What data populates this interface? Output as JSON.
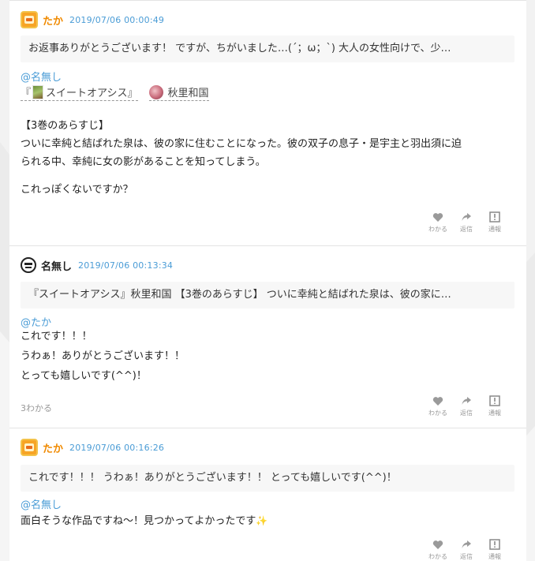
{
  "posts": [
    {
      "username": "たか",
      "timestamp": "2019/07/06 00:00:49",
      "quote": "お返事ありがとうございます！ ですが、ちがいました…(´；ω；`) 大人の女性向けで、少…",
      "mention": "@名無し",
      "work_title": "『 スイートオアシス』",
      "author_name": "秋里和国",
      "body_lines": [
        "【3巻のあらすじ】",
        "ついに幸純と結ばれた泉は、彼の家に住むことになった。彼の双子の息子・是宇主と羽出須に迫",
        "られる中、幸純に女の影があることを知ってしまう。",
        "",
        "これっぽくないですか？"
      ],
      "actions": [
        "わかる",
        "返信",
        "通報"
      ]
    },
    {
      "username": "名無し",
      "timestamp": "2019/07/06 00:13:34",
      "quote": "『スイートオアシス』秋里和国 【3巻のあらすじ】 ついに幸純と結ばれた泉は、彼の家に…",
      "mention": "@たか",
      "body_lines": [
        "これです！！！",
        "うわぁ！ありがとうございます！！",
        "とっても嬉しいです(^^)！"
      ],
      "like_count": "3わかる",
      "actions": [
        "わかる",
        "返信",
        "通報"
      ]
    },
    {
      "username": "たか",
      "timestamp": "2019/07/06 00:16:26",
      "quote": "これです！！！ うわぁ！ありがとうございます！！ とっても嬉しいです(^^)！",
      "mention": "@名無し",
      "body_line": "面白そうな作品ですね〜！見つかってよかったです",
      "sparkle": "✨",
      "actions": [
        "わかる",
        "返信",
        "通報"
      ]
    }
  ],
  "colors": {
    "accent_blue": "#4a9cd6",
    "username_orange": "#f08a00",
    "background": "#f2f2f2"
  },
  "icons": {
    "avatar_1": "orange-box-avatar-icon",
    "avatar_2": "mask-avatar-icon",
    "like": "heart-icon",
    "reply": "reply-arrow-icon",
    "report": "report-exclamation-icon"
  }
}
